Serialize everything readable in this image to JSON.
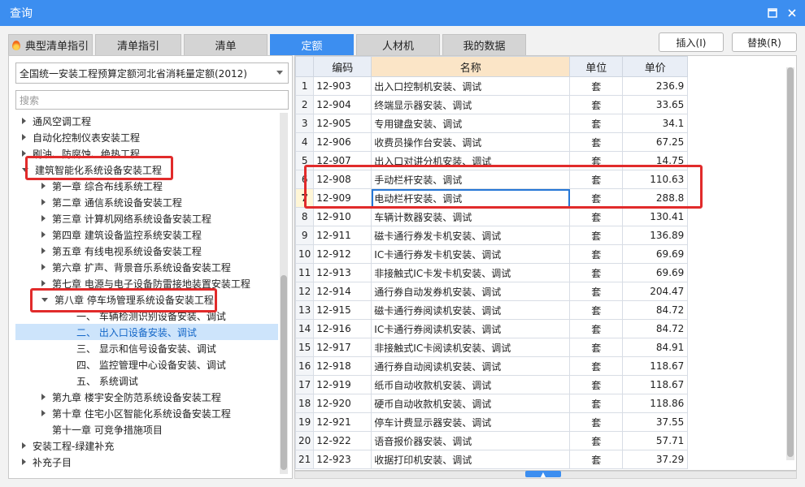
{
  "window": {
    "title": "查询",
    "maximize_icon": "maximize-icon",
    "close_icon": "close-icon"
  },
  "tabs": [
    {
      "label": "典型清单指引",
      "icon": "flame-icon",
      "active": false
    },
    {
      "label": "清单指引",
      "active": false
    },
    {
      "label": "清单",
      "active": false
    },
    {
      "label": "定额",
      "active": true
    },
    {
      "label": "人材机",
      "active": false
    },
    {
      "label": "我的数据",
      "active": false
    }
  ],
  "actions": {
    "insert_label": "插入(I)",
    "replace_label": "替换(R)"
  },
  "left": {
    "quota_library": "全国统一安装工程预算定额河北省消耗量定额(2012)",
    "search_placeholder": "搜索",
    "tree": [
      {
        "label": "通风空调工程",
        "expander": "right"
      },
      {
        "label": "自动化控制仪表安装工程",
        "expander": "right"
      },
      {
        "label": "刷油、防腐蚀、绝热工程",
        "expander": "right"
      },
      {
        "label": "建筑智能化系统设备安装工程",
        "expander": "down"
      },
      {
        "label": "第一章 综合布线系统工程",
        "expander": "right"
      },
      {
        "label": "第二章 通信系统设备安装工程",
        "expander": "right"
      },
      {
        "label": "第三章 计算机网络系统设备安装工程",
        "expander": "right"
      },
      {
        "label": "第四章 建筑设备监控系统安装工程",
        "expander": "right"
      },
      {
        "label": "第五章 有线电视系统设备安装工程",
        "expander": "right"
      },
      {
        "label": "第六章 扩声、背景音乐系统设备安装工程",
        "expander": "right"
      },
      {
        "label": "第七章 电源与电子设备防雷接地装置安装工程",
        "expander": "right"
      },
      {
        "label": "第八章 停车场管理系统设备安装工程",
        "expander": "down"
      },
      {
        "label": "一、 车辆检测识别设备安装、调试",
        "expander": "none"
      },
      {
        "label": "二、 出入口设备安装、调试",
        "expander": "none",
        "selected": true
      },
      {
        "label": "三、 显示和信号设备安装、调试",
        "expander": "none"
      },
      {
        "label": "四、 监控管理中心设备安装、调试",
        "expander": "none"
      },
      {
        "label": "五、 系统调试",
        "expander": "none"
      },
      {
        "label": "第九章 楼宇安全防范系统设备安装工程",
        "expander": "right"
      },
      {
        "label": "第十章 住宅小区智能化系统设备安装工程",
        "expander": "right"
      },
      {
        "label": "第十一章 可竞争措施项目",
        "expander": "none"
      },
      {
        "label": "安装工程-绿建补充",
        "expander": "right"
      },
      {
        "label": "补充子目",
        "expander": "right"
      }
    ]
  },
  "table": {
    "headers": {
      "code": "编码",
      "name": "名称",
      "unit": "单位",
      "price": "单价"
    },
    "rows": [
      {
        "idx": "1",
        "code": "12-903",
        "name": "出入口控制机安装、调试",
        "unit": "套",
        "price": "236.9"
      },
      {
        "idx": "2",
        "code": "12-904",
        "name": "终端显示器安装、调试",
        "unit": "套",
        "price": "33.65"
      },
      {
        "idx": "3",
        "code": "12-905",
        "name": "专用键盘安装、调试",
        "unit": "套",
        "price": "34.1"
      },
      {
        "idx": "4",
        "code": "12-906",
        "name": "收费员操作台安装、调试",
        "unit": "套",
        "price": "67.25"
      },
      {
        "idx": "5",
        "code": "12-907",
        "name": "出入口对讲分机安装、调试",
        "unit": "套",
        "price": "14.75"
      },
      {
        "idx": "6",
        "code": "12-908",
        "name": "手动栏杆安装、调试",
        "unit": "套",
        "price": "110.63"
      },
      {
        "idx": "7",
        "code": "12-909",
        "name": "电动栏杆安装、调试",
        "unit": "套",
        "price": "288.8",
        "current": true
      },
      {
        "idx": "8",
        "code": "12-910",
        "name": "车辆计数器安装、调试",
        "unit": "套",
        "price": "130.41"
      },
      {
        "idx": "9",
        "code": "12-911",
        "name": "磁卡通行券发卡机安装、调试",
        "unit": "套",
        "price": "136.89"
      },
      {
        "idx": "10",
        "code": "12-912",
        "name": "IC卡通行券发卡机安装、调试",
        "unit": "套",
        "price": "69.69"
      },
      {
        "idx": "11",
        "code": "12-913",
        "name": "非接触式IC卡发卡机安装、调试",
        "unit": "套",
        "price": "69.69"
      },
      {
        "idx": "12",
        "code": "12-914",
        "name": "通行券自动发券机安装、调试",
        "unit": "套",
        "price": "204.47"
      },
      {
        "idx": "13",
        "code": "12-915",
        "name": "磁卡通行券阅读机安装、调试",
        "unit": "套",
        "price": "84.72"
      },
      {
        "idx": "14",
        "code": "12-916",
        "name": "IC卡通行券阅读机安装、调试",
        "unit": "套",
        "price": "84.72"
      },
      {
        "idx": "15",
        "code": "12-917",
        "name": "非接触式IC卡阅读机安装、调试",
        "unit": "套",
        "price": "84.91"
      },
      {
        "idx": "16",
        "code": "12-918",
        "name": "通行券自动阅读机安装、调试",
        "unit": "套",
        "price": "118.67"
      },
      {
        "idx": "17",
        "code": "12-919",
        "name": "纸币自动收款机安装、调试",
        "unit": "套",
        "price": "118.67"
      },
      {
        "idx": "18",
        "code": "12-920",
        "name": "硬币自动收款机安装、调试",
        "unit": "套",
        "price": "118.86"
      },
      {
        "idx": "19",
        "code": "12-921",
        "name": "停车计费显示器安装、调试",
        "unit": "套",
        "price": "37.55"
      },
      {
        "idx": "20",
        "code": "12-922",
        "name": "语音报价器安装、调试",
        "unit": "套",
        "price": "57.71"
      },
      {
        "idx": "21",
        "code": "12-923",
        "name": "收据打印机安装、调试",
        "unit": "套",
        "price": "37.29"
      }
    ]
  },
  "colors": {
    "accent": "#3c8ef0",
    "highlight": "#e12b2b",
    "selection": "#cde4fb"
  }
}
